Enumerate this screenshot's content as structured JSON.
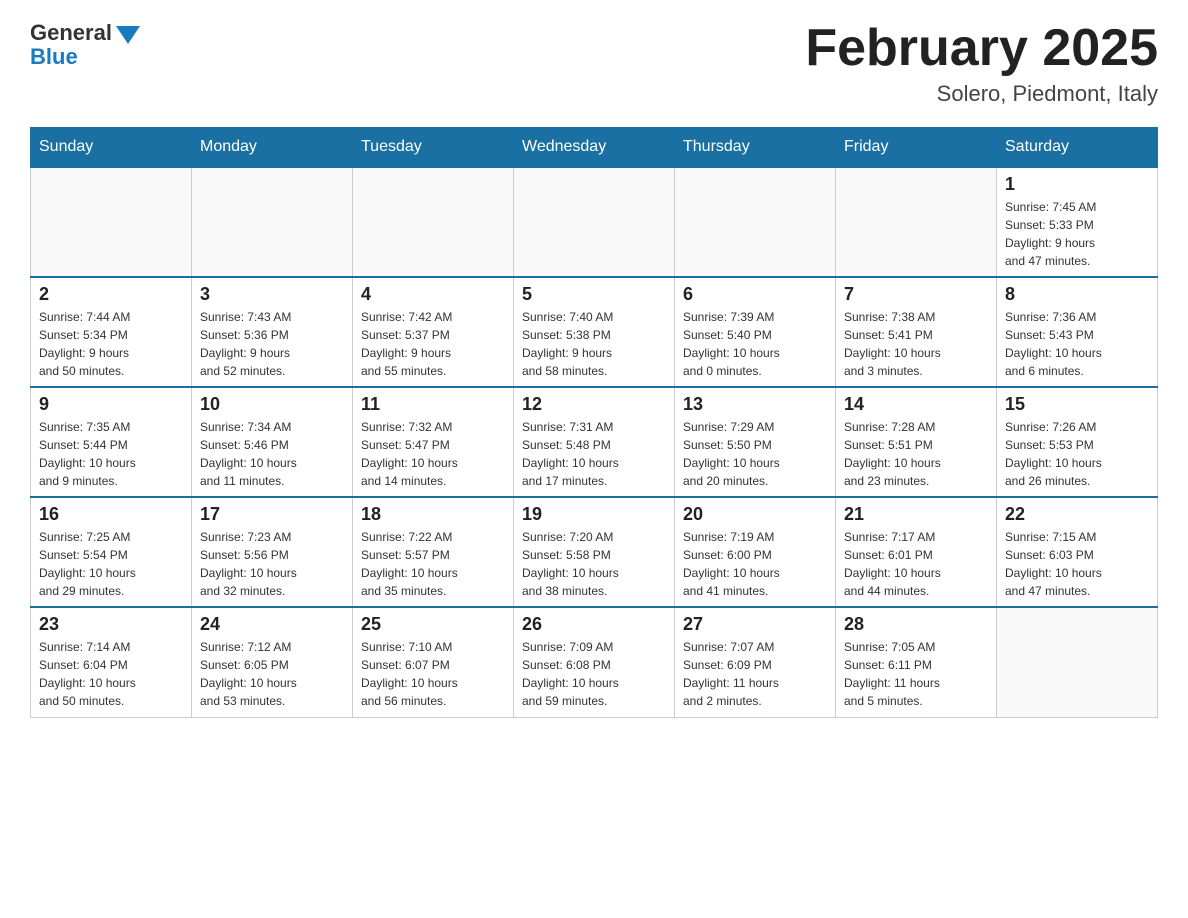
{
  "header": {
    "logo_general": "General",
    "logo_blue": "Blue",
    "month_title": "February 2025",
    "location": "Solero, Piedmont, Italy"
  },
  "days_of_week": [
    "Sunday",
    "Monday",
    "Tuesday",
    "Wednesday",
    "Thursday",
    "Friday",
    "Saturday"
  ],
  "weeks": [
    [
      {
        "day": "",
        "info": ""
      },
      {
        "day": "",
        "info": ""
      },
      {
        "day": "",
        "info": ""
      },
      {
        "day": "",
        "info": ""
      },
      {
        "day": "",
        "info": ""
      },
      {
        "day": "",
        "info": ""
      },
      {
        "day": "1",
        "info": "Sunrise: 7:45 AM\nSunset: 5:33 PM\nDaylight: 9 hours\nand 47 minutes."
      }
    ],
    [
      {
        "day": "2",
        "info": "Sunrise: 7:44 AM\nSunset: 5:34 PM\nDaylight: 9 hours\nand 50 minutes."
      },
      {
        "day": "3",
        "info": "Sunrise: 7:43 AM\nSunset: 5:36 PM\nDaylight: 9 hours\nand 52 minutes."
      },
      {
        "day": "4",
        "info": "Sunrise: 7:42 AM\nSunset: 5:37 PM\nDaylight: 9 hours\nand 55 minutes."
      },
      {
        "day": "5",
        "info": "Sunrise: 7:40 AM\nSunset: 5:38 PM\nDaylight: 9 hours\nand 58 minutes."
      },
      {
        "day": "6",
        "info": "Sunrise: 7:39 AM\nSunset: 5:40 PM\nDaylight: 10 hours\nand 0 minutes."
      },
      {
        "day": "7",
        "info": "Sunrise: 7:38 AM\nSunset: 5:41 PM\nDaylight: 10 hours\nand 3 minutes."
      },
      {
        "day": "8",
        "info": "Sunrise: 7:36 AM\nSunset: 5:43 PM\nDaylight: 10 hours\nand 6 minutes."
      }
    ],
    [
      {
        "day": "9",
        "info": "Sunrise: 7:35 AM\nSunset: 5:44 PM\nDaylight: 10 hours\nand 9 minutes."
      },
      {
        "day": "10",
        "info": "Sunrise: 7:34 AM\nSunset: 5:46 PM\nDaylight: 10 hours\nand 11 minutes."
      },
      {
        "day": "11",
        "info": "Sunrise: 7:32 AM\nSunset: 5:47 PM\nDaylight: 10 hours\nand 14 minutes."
      },
      {
        "day": "12",
        "info": "Sunrise: 7:31 AM\nSunset: 5:48 PM\nDaylight: 10 hours\nand 17 minutes."
      },
      {
        "day": "13",
        "info": "Sunrise: 7:29 AM\nSunset: 5:50 PM\nDaylight: 10 hours\nand 20 minutes."
      },
      {
        "day": "14",
        "info": "Sunrise: 7:28 AM\nSunset: 5:51 PM\nDaylight: 10 hours\nand 23 minutes."
      },
      {
        "day": "15",
        "info": "Sunrise: 7:26 AM\nSunset: 5:53 PM\nDaylight: 10 hours\nand 26 minutes."
      }
    ],
    [
      {
        "day": "16",
        "info": "Sunrise: 7:25 AM\nSunset: 5:54 PM\nDaylight: 10 hours\nand 29 minutes."
      },
      {
        "day": "17",
        "info": "Sunrise: 7:23 AM\nSunset: 5:56 PM\nDaylight: 10 hours\nand 32 minutes."
      },
      {
        "day": "18",
        "info": "Sunrise: 7:22 AM\nSunset: 5:57 PM\nDaylight: 10 hours\nand 35 minutes."
      },
      {
        "day": "19",
        "info": "Sunrise: 7:20 AM\nSunset: 5:58 PM\nDaylight: 10 hours\nand 38 minutes."
      },
      {
        "day": "20",
        "info": "Sunrise: 7:19 AM\nSunset: 6:00 PM\nDaylight: 10 hours\nand 41 minutes."
      },
      {
        "day": "21",
        "info": "Sunrise: 7:17 AM\nSunset: 6:01 PM\nDaylight: 10 hours\nand 44 minutes."
      },
      {
        "day": "22",
        "info": "Sunrise: 7:15 AM\nSunset: 6:03 PM\nDaylight: 10 hours\nand 47 minutes."
      }
    ],
    [
      {
        "day": "23",
        "info": "Sunrise: 7:14 AM\nSunset: 6:04 PM\nDaylight: 10 hours\nand 50 minutes."
      },
      {
        "day": "24",
        "info": "Sunrise: 7:12 AM\nSunset: 6:05 PM\nDaylight: 10 hours\nand 53 minutes."
      },
      {
        "day": "25",
        "info": "Sunrise: 7:10 AM\nSunset: 6:07 PM\nDaylight: 10 hours\nand 56 minutes."
      },
      {
        "day": "26",
        "info": "Sunrise: 7:09 AM\nSunset: 6:08 PM\nDaylight: 10 hours\nand 59 minutes."
      },
      {
        "day": "27",
        "info": "Sunrise: 7:07 AM\nSunset: 6:09 PM\nDaylight: 11 hours\nand 2 minutes."
      },
      {
        "day": "28",
        "info": "Sunrise: 7:05 AM\nSunset: 6:11 PM\nDaylight: 11 hours\nand 5 minutes."
      },
      {
        "day": "",
        "info": ""
      }
    ]
  ]
}
